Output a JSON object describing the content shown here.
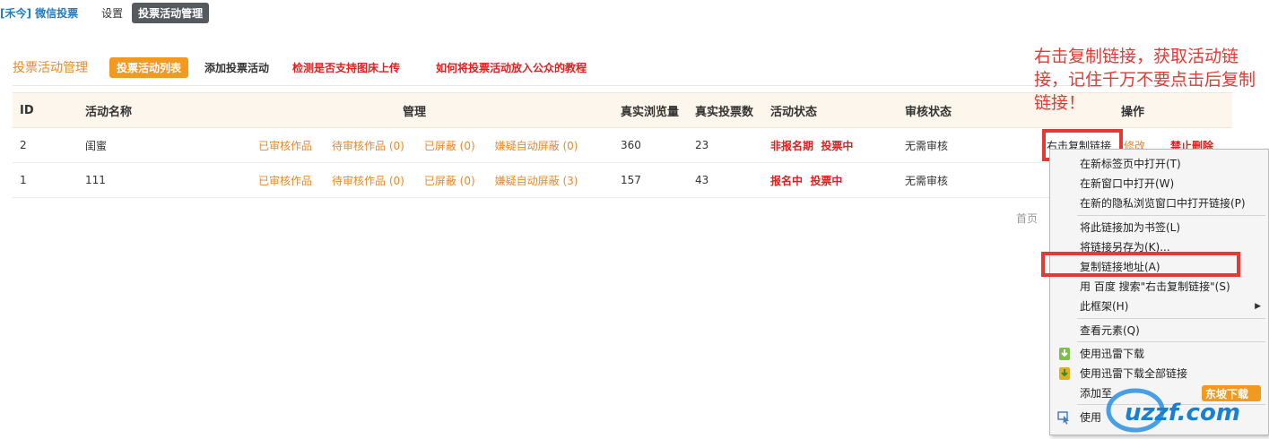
{
  "topnav": {
    "brand": "[禾今] 微信投票",
    "settings": "设置",
    "active": "投票活动管理"
  },
  "subbar": {
    "title": "投票活动管理",
    "list": "投票活动列表",
    "add": "添加投票活动",
    "check": "检测是否支持图床上传",
    "tutorial": "如何将投票活动放入公众的教程"
  },
  "table": {
    "headers": {
      "id": "ID",
      "name": "活动名称",
      "manage": "管理",
      "views": "真实浏览量",
      "votes": "真实投票数",
      "status": "活动状态",
      "audit": "审核状态",
      "ops": "操作"
    },
    "rows": [
      {
        "id": "2",
        "name": "闺蜜",
        "approved": "已审核作品",
        "pending": "待审核作品 (0)",
        "blocked": "已屏蔽 (0)",
        "auto_blocked": "嫌疑自动屏蔽 (0)",
        "views": "360",
        "votes": "23",
        "status1": "非报名期",
        "status2": "投票中",
        "audit": "无需审核",
        "op_copy": "右击复制链接",
        "op_edit": "修改",
        "op_delete": "禁止删除"
      },
      {
        "id": "1",
        "name": "111",
        "approved": "已审核作品",
        "pending": "待审核作品 (0)",
        "blocked": "已屏蔽 (0)",
        "auto_blocked": "嫌疑自动屏蔽 (3)",
        "views": "157",
        "votes": "43",
        "status1": "报名中",
        "status2": "投票中",
        "audit": "无需审核"
      }
    ]
  },
  "pager": {
    "first": "首页"
  },
  "annotation": "右击复制链接，获取活动链接，记住千万不要点击后复制链接！",
  "context_menu": {
    "items": {
      "open_new_tab": "在新标签页中打开(T)",
      "open_new_window": "在新窗口中打开(W)",
      "open_private": "在新的隐私浏览窗口中打开链接(P)",
      "bookmark": "将此链接加为书签(L)",
      "save_as": "将链接另存为(K)...",
      "copy_link": "复制链接地址(A)",
      "search": "用 百度 搜索\"右击复制链接\"(S)",
      "frame": "此框架(H)",
      "inspect": "查看元素(Q)",
      "thunder_download": "使用迅雷下载",
      "thunder_all": "使用迅雷下载全部链接",
      "add_to": "添加至",
      "use": "使用"
    }
  },
  "watermark": {
    "text": "uzzf.com",
    "badge": "东坡下载"
  },
  "colors": {
    "accent_orange": "#f29a1f",
    "brand_blue": "#1a7fcf",
    "alert_red": "#e53935",
    "header_bg": "#fdf6ec"
  }
}
